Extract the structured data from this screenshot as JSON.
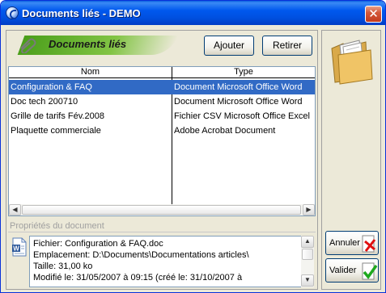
{
  "window": {
    "title": "Documents liés - DEMO",
    "close_glyph": "✕"
  },
  "header": {
    "logo_text": "Documents liés",
    "add_label": "Ajouter",
    "remove_label": "Retirer"
  },
  "table": {
    "columns": [
      "Nom",
      "Type"
    ],
    "rows": [
      {
        "name": "Configuration & FAQ",
        "type": "Document Microsoft Office Word",
        "selected": true
      },
      {
        "name": "Doc tech 200710",
        "type": "Document Microsoft Office Word",
        "selected": false
      },
      {
        "name": "Grille de tarifs Fév.2008",
        "type": "Fichier CSV Microsoft Office Excel",
        "selected": false
      },
      {
        "name": "Plaquette commerciale",
        "type": "Adobe Acrobat Document",
        "selected": false
      }
    ]
  },
  "properties": {
    "label": "Propriétés du document",
    "lines": [
      "Fichier: Configuration & FAQ.doc",
      "Emplacement: D:\\Documents\\Documentations articles\\",
      "Taille: 31,00 ko",
      "Modifié le: 31/05/2007 à 09:15   (créé le: 31/10/2007 à"
    ]
  },
  "actions": {
    "cancel_label": "Annuler",
    "ok_label": "Valider"
  },
  "colors": {
    "titlebar": "#0050e0",
    "selection": "#316ac5",
    "accent_green": "#4a9e1a"
  },
  "icons": {
    "app": "app-icon",
    "logo": "paperclip-icon",
    "document": "word-document-icon",
    "folder": "folder-icon",
    "cancel": "red-cancel-icon",
    "ok": "green-check-icon"
  }
}
